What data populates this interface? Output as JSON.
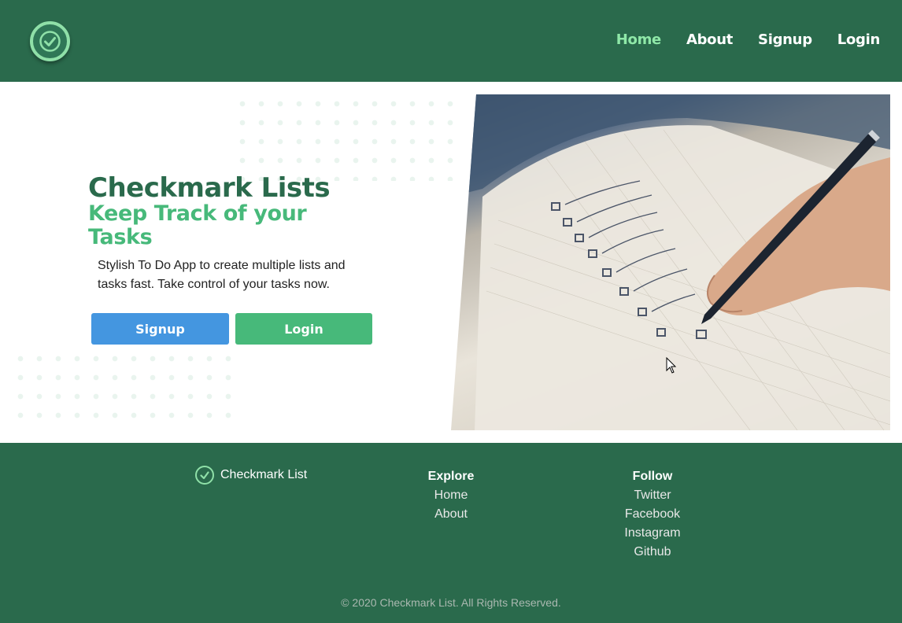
{
  "header": {
    "nav": [
      {
        "label": "Home",
        "active": true
      },
      {
        "label": "About",
        "active": false
      },
      {
        "label": "Signup",
        "active": false
      },
      {
        "label": "Login",
        "active": false
      }
    ]
  },
  "hero": {
    "title": "Checkmark Lists",
    "subtitle": "Keep Track of your Tasks",
    "description": "Stylish To Do App to create multiple lists and tasks fast. Take control of your tasks now.",
    "signup_label": "Signup",
    "login_label": "Login"
  },
  "footer": {
    "brand": "Checkmark List",
    "explore": {
      "heading": "Explore",
      "links": [
        "Home",
        "About"
      ]
    },
    "follow": {
      "heading": "Follow",
      "links": [
        "Twitter",
        "Facebook",
        "Instagram",
        "Github"
      ]
    },
    "copyright": "© 2020 Checkmark List. All Rights Reserved."
  },
  "colors": {
    "brand_green": "#2a6a4c",
    "accent_green": "#47b97a",
    "active_nav": "#8fe8a8",
    "signup_blue": "#4496e0"
  }
}
